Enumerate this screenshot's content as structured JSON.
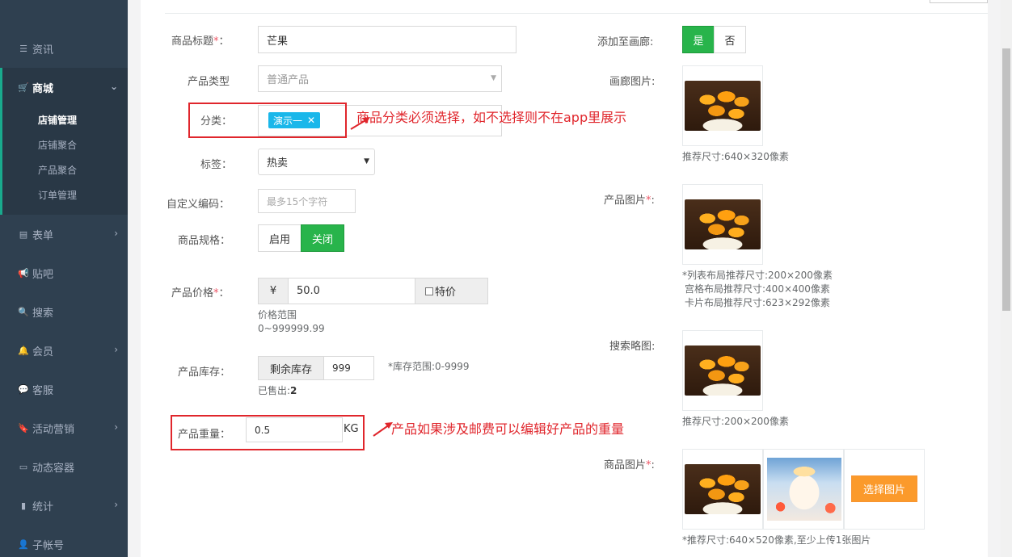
{
  "sidebar": {
    "items": [
      {
        "label": "资讯",
        "icon": "list-icon"
      },
      {
        "label": "商城",
        "icon": "cart-icon"
      },
      {
        "label": "表单",
        "icon": "form-icon"
      },
      {
        "label": "贴吧",
        "icon": "bullhorn-icon"
      },
      {
        "label": "搜索",
        "icon": "search-icon"
      },
      {
        "label": "会员",
        "icon": "bell-icon"
      },
      {
        "label": "客服",
        "icon": "comment-icon"
      },
      {
        "label": "活动营销",
        "icon": "bookmark-icon"
      },
      {
        "label": "动态容器",
        "icon": "hdd-icon"
      },
      {
        "label": "统计",
        "icon": "bar-chart-icon"
      },
      {
        "label": "子帐号",
        "icon": "user-icon"
      }
    ],
    "sub_items": [
      "店铺管理",
      "店铺聚合",
      "产品聚合",
      "订单管理"
    ]
  },
  "form": {
    "title_label": "商品标题",
    "title_value": "芒果",
    "type_label": "产品类型",
    "type_value": "普通产品",
    "category_label": "分类：",
    "category_tag": "演示一",
    "tag_label": "标签：",
    "tag_value": "热卖",
    "code_label": "自定义编码：",
    "code_placeholder": "最多15个字符",
    "spec_label": "商品规格：",
    "spec_on": "启用",
    "spec_off": "关闭",
    "price_label": "产品价格",
    "price_currency": "¥",
    "price_value": "50.0",
    "price_special": "特价",
    "price_range_title": "价格范围",
    "price_range": "0~999999.99",
    "stock_label": "产品库存：",
    "stock_addon": "剩余库存",
    "stock_value": "999",
    "stock_hint": "*库存范围:0-9999",
    "sold_label": "已售出:",
    "sold_value": "2",
    "weight_label": "产品重量：",
    "weight_value": "0.5",
    "weight_unit": "KG"
  },
  "right": {
    "gallery_label": "添加至画廊:",
    "gallery_yes": "是",
    "gallery_no": "否",
    "gallery_img_label": "画廊图片:",
    "gallery_hint": "推荐尺寸:640×320像素",
    "product_img_label": "产品图片",
    "product_hint_1": "*列表布局推荐尺寸:200×200像素",
    "product_hint_2": "宫格布局推荐尺寸:400×400像素",
    "product_hint_3": "卡片布局推荐尺寸:623×292像素",
    "search_img_label": "搜索略图:",
    "search_hint": "推荐尺寸:200×200像素",
    "goods_img_label": "商品图片",
    "choose_btn": "选择图片",
    "goods_hint": "*推荐尺寸:640×520像素,至少上传1张图片"
  },
  "annotations": {
    "category_note": "商品分类必须选择，如不选择则不在app里展示",
    "weight_note": "产品如果涉及邮费可以编辑好产品的重量"
  },
  "colors": {
    "accent": "#19aa8d",
    "green": "#28b44b",
    "orange": "#fb9a2b",
    "red_note": "#e0262c",
    "tag": "#1ab7ea"
  }
}
